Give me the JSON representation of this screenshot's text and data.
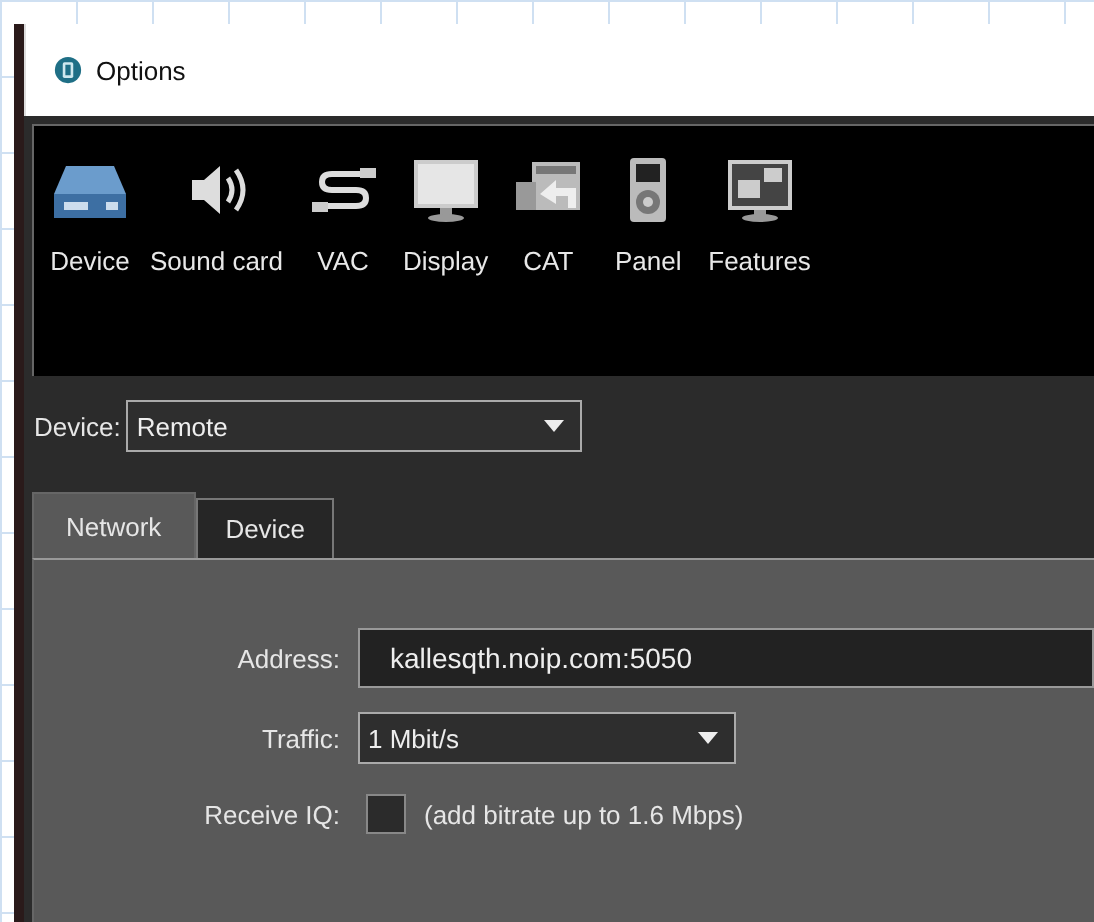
{
  "window": {
    "title": "Options"
  },
  "toolbar": [
    {
      "label": "Device"
    },
    {
      "label": "Sound card"
    },
    {
      "label": "VAC"
    },
    {
      "label": "Display"
    },
    {
      "label": "CAT"
    },
    {
      "label": "Panel"
    },
    {
      "label": "Features"
    }
  ],
  "device": {
    "label": "Device:",
    "value": "Remote"
  },
  "tabs": [
    {
      "label": "Network",
      "selected": true
    },
    {
      "label": "Device",
      "selected": false
    }
  ],
  "network": {
    "address": {
      "label": "Address:",
      "value": "kallesqth.noip.com:5050"
    },
    "traffic": {
      "label": "Traffic:",
      "value": "1 Mbit/s"
    },
    "receive_iq": {
      "label": "Receive IQ:",
      "checked": false,
      "note": "(add bitrate up to 1.6 Mbps)"
    }
  }
}
